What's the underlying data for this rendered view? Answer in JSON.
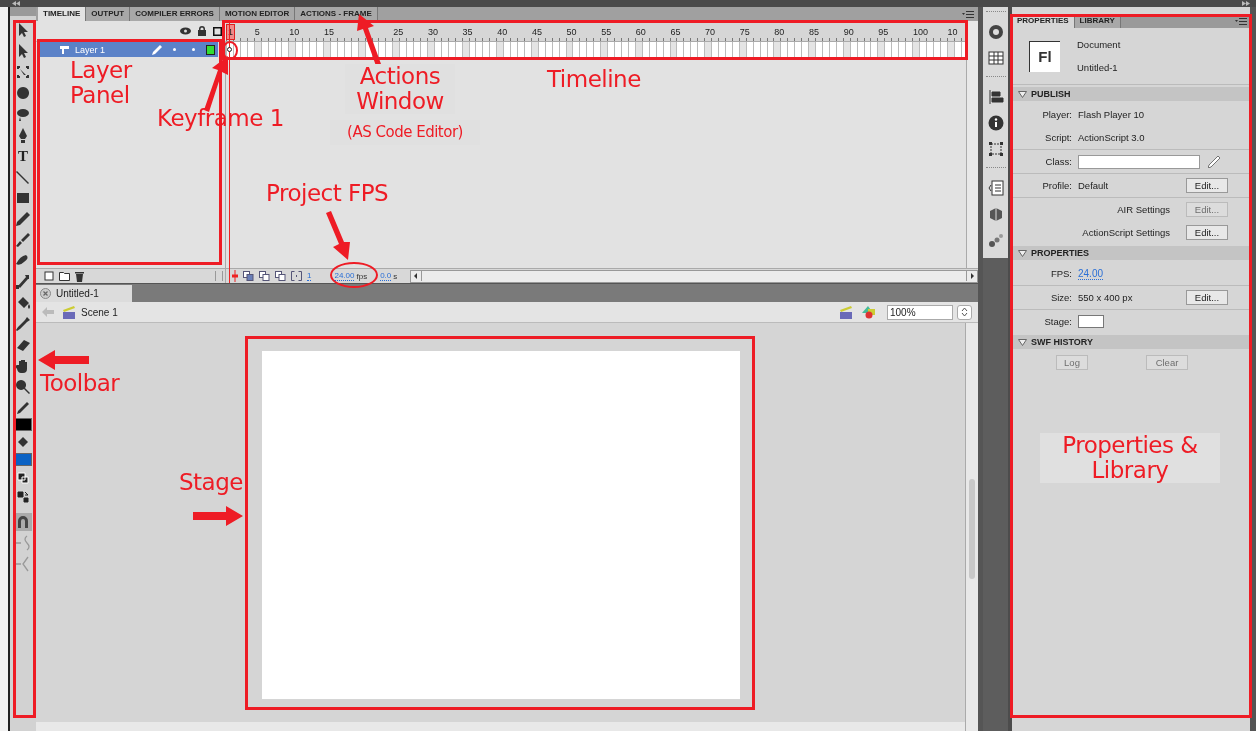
{
  "timeline": {
    "tabs": [
      {
        "label": "TIMELINE",
        "selected": true
      },
      {
        "label": "OUTPUT",
        "selected": false
      },
      {
        "label": "COMPILER ERRORS",
        "selected": false
      },
      {
        "label": "MOTION EDITOR",
        "selected": false
      },
      {
        "label": "ACTIONS - FRAME",
        "selected": false
      }
    ],
    "ruler": [
      {
        "label": "1",
        "current": true
      },
      {
        "label": "5",
        "current": false
      },
      {
        "label": "10",
        "current": false
      },
      {
        "label": "15",
        "current": false
      }
    ],
    "ruler_after_arrow": [
      {
        "label": "25",
        "current": false
      },
      {
        "label": "30",
        "current": false
      },
      {
        "label": "35",
        "current": false
      },
      {
        "label": "40",
        "current": false
      },
      {
        "label": "45",
        "current": false
      },
      {
        "label": "50",
        "current": false
      },
      {
        "label": "55",
        "current": false
      },
      {
        "label": "60",
        "current": false
      },
      {
        "label": "65",
        "current": false
      },
      {
        "label": "70",
        "current": false
      },
      {
        "label": "75",
        "current": false
      },
      {
        "label": "80",
        "current": false
      },
      {
        "label": "85",
        "current": false
      },
      {
        "label": "90",
        "current": false
      },
      {
        "label": "95",
        "current": false
      },
      {
        "label": "100",
        "current": false
      },
      {
        "label": "10",
        "current": false
      }
    ],
    "layers": [
      {
        "name": "Layer 1",
        "selected": true,
        "keyframe": true
      }
    ],
    "status": {
      "current_frame": "1",
      "fps": "24.00",
      "fps_unit": "fps",
      "elapsed": "0.0",
      "elapsed_unit": "s"
    }
  },
  "toolbar": {
    "text_tool": "T"
  },
  "document": {
    "tab": "Untitled-1",
    "scene": "Scene 1",
    "zoom": "100%"
  },
  "properties": {
    "tabs": [
      {
        "label": "PROPERTIES",
        "selected": true
      },
      {
        "label": "LIBRARY",
        "selected": false
      }
    ],
    "logo": "Fl",
    "doc_type": "Document",
    "doc_name": "Untitled-1",
    "sections": [
      {
        "title": "PUBLISH",
        "expanded": true,
        "groups": [
          [
            {
              "kind": "text",
              "label": "Player:",
              "value": "Flash Player 10"
            },
            {
              "kind": "text",
              "label": "Script:",
              "value": "ActionScript 3.0"
            }
          ],
          [
            {
              "kind": "field",
              "label": "Class:"
            }
          ],
          [
            {
              "kind": "text",
              "label": "Profile:",
              "value": "Default",
              "button": {
                "label": "Edit...",
                "disabled": false
              }
            }
          ],
          [
            {
              "kind": "setting",
              "label": "AIR Settings",
              "button": {
                "label": "Edit...",
                "disabled": true
              }
            },
            {
              "kind": "setting",
              "label": "ActionScript Settings",
              "button": {
                "label": "Edit...",
                "disabled": false
              }
            }
          ]
        ]
      },
      {
        "title": "PROPERTIES",
        "expanded": true,
        "groups": [
          [
            {
              "kind": "link",
              "label": "FPS:",
              "value": "24.00"
            }
          ],
          [
            {
              "kind": "text",
              "label": "Size:",
              "value": "550 x 400 px",
              "button": {
                "label": "Edit...",
                "disabled": false
              }
            }
          ],
          [
            {
              "kind": "swatch",
              "label": "Stage:",
              "color": "#ffffff"
            }
          ]
        ]
      },
      {
        "title": "SWF HISTORY",
        "expanded": true,
        "groups": [
          [
            {
              "kind": "buttons",
              "buttons": [
                {
                  "label": "Log",
                  "disabled": true
                },
                {
                  "label": "Clear",
                  "disabled": true
                }
              ]
            }
          ]
        ]
      }
    ]
  },
  "annotations": [
    {
      "text": "Layer Panel"
    },
    {
      "text": "Keyframe 1"
    },
    {
      "text": "Actions Window"
    },
    {
      "text": "(AS Code Editor)"
    },
    {
      "text": "Timeline"
    },
    {
      "text": "Project FPS"
    },
    {
      "text": "Toolbar"
    },
    {
      "text": "Stage"
    },
    {
      "text": "Properties & Library"
    }
  ]
}
